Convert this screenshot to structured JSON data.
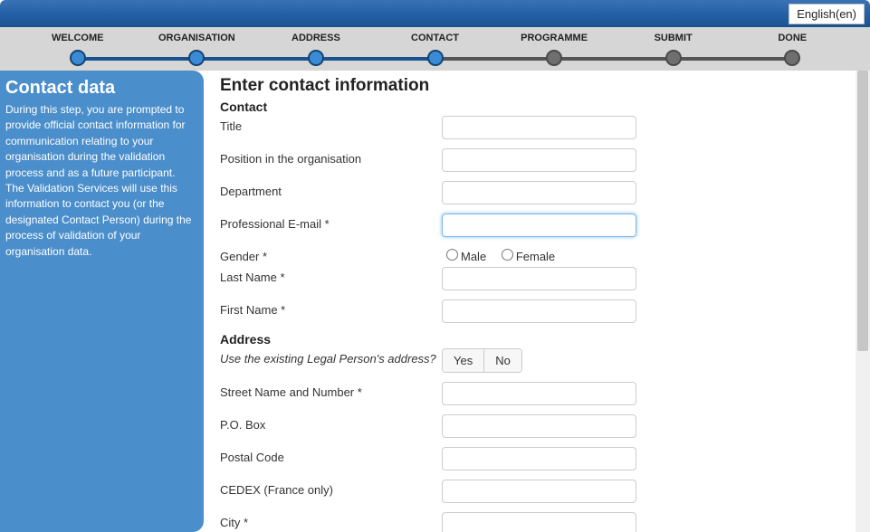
{
  "language": "English(en)",
  "steps": [
    {
      "label": "WELCOME",
      "state": "done"
    },
    {
      "label": "ORGANISATION",
      "state": "done"
    },
    {
      "label": "ADDRESS",
      "state": "done"
    },
    {
      "label": "CONTACT",
      "state": "active"
    },
    {
      "label": "PROGRAMME",
      "state": "todo"
    },
    {
      "label": "SUBMIT",
      "state": "todo"
    },
    {
      "label": "DONE",
      "state": "todo"
    }
  ],
  "sidebar": {
    "title": "Contact data",
    "body": "During this step, you are prompted to provide official contact information for communication relating to your organisation during the validation process and as a future participant. The Validation Services will use this information to contact you (or the designated Contact Person) during the process of validation of your organisation data."
  },
  "form": {
    "heading": "Enter contact information",
    "contact": {
      "section": "Contact",
      "title": "Title",
      "position": "Position in the organisation",
      "department": "Department",
      "email": "Professional E-mail *",
      "gender": "Gender *",
      "gender_male": "Male",
      "gender_female": "Female",
      "last_name": "Last Name *",
      "first_name": "First Name *"
    },
    "address": {
      "section": "Address",
      "use_existing": "Use the existing Legal Person's address?",
      "yes": "Yes",
      "no": "No",
      "street": "Street Name and Number *",
      "po_box": "P.O. Box",
      "postal_code": "Postal Code",
      "cedex": "CEDEX (France only)",
      "city": "City *"
    }
  }
}
